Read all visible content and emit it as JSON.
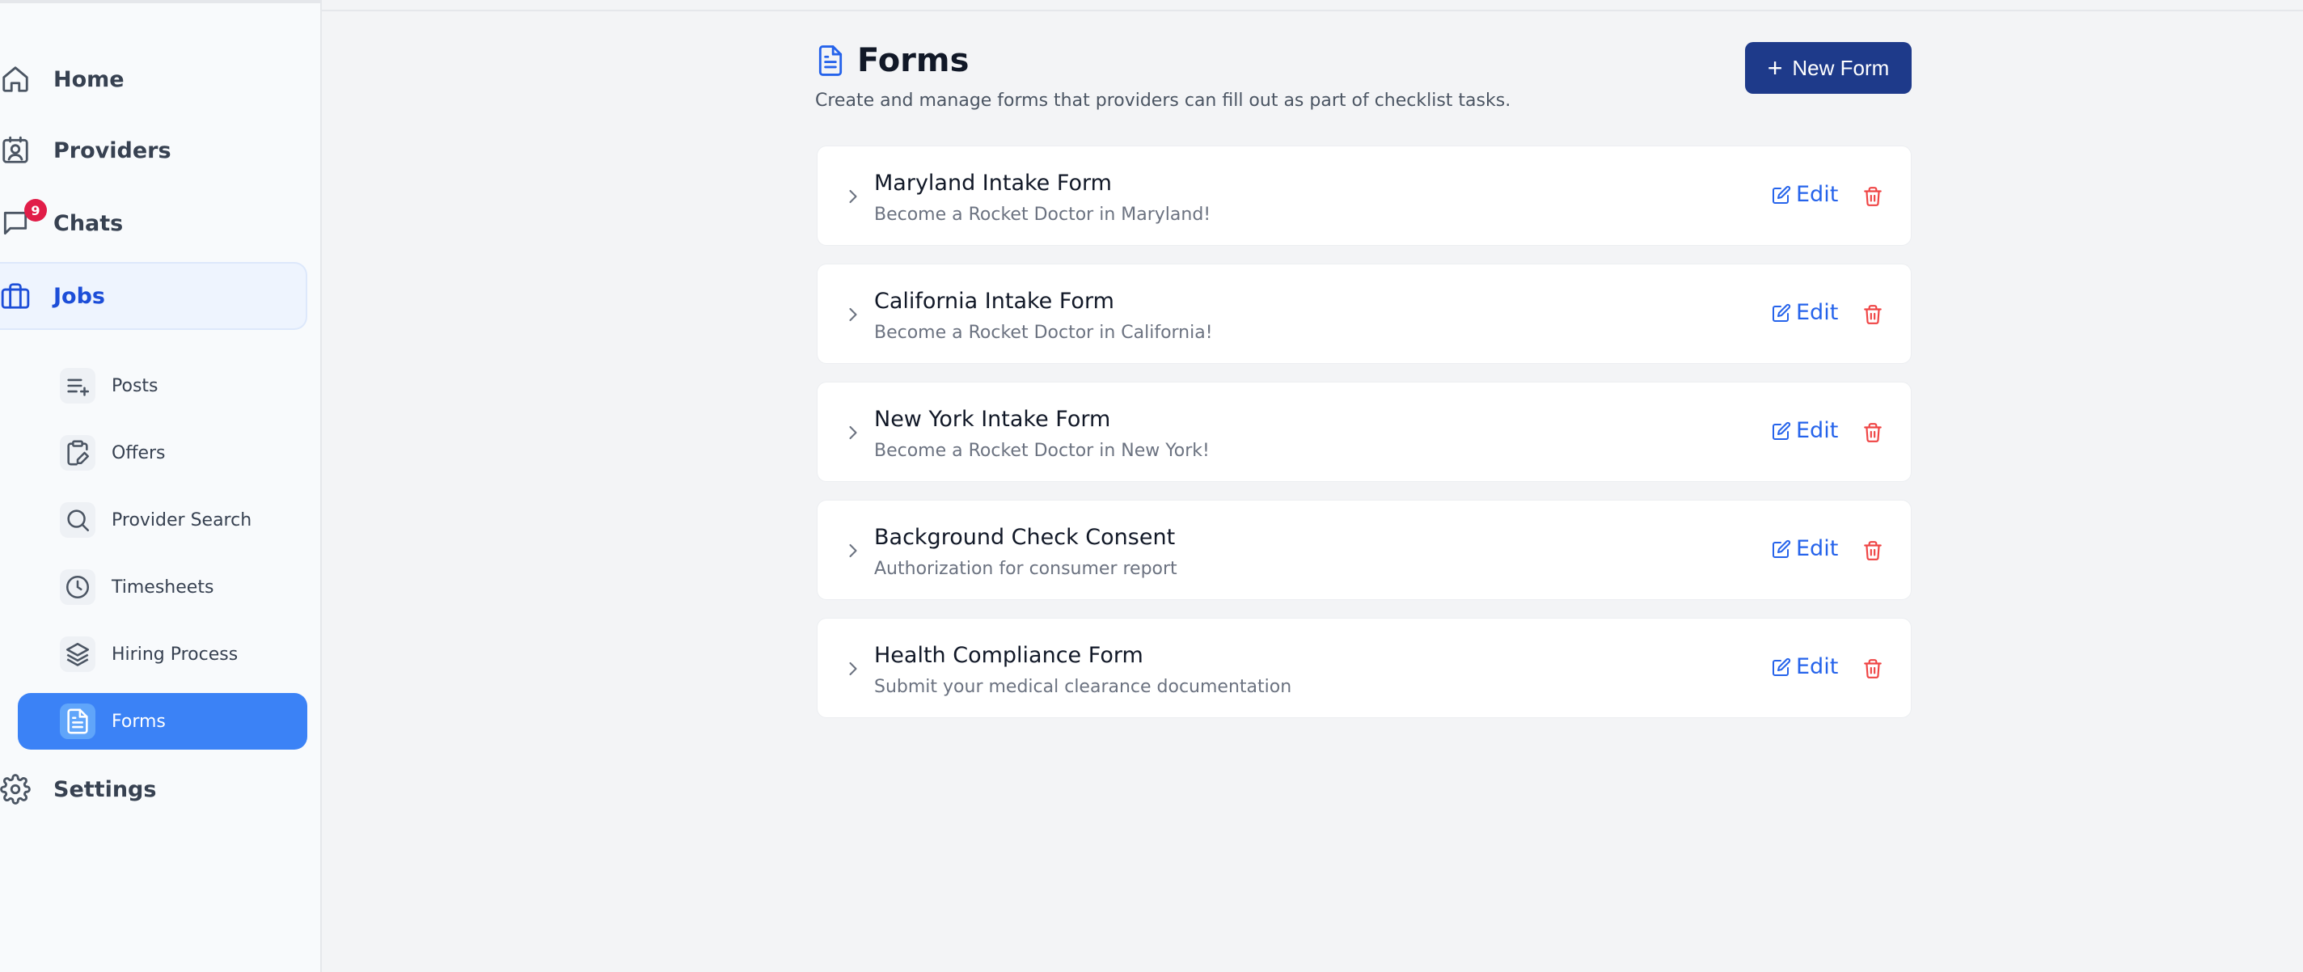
{
  "sidebar": {
    "items": [
      {
        "label": "Home",
        "icon": "home-icon"
      },
      {
        "label": "Providers",
        "icon": "contact-icon"
      },
      {
        "label": "Chats",
        "icon": "chat-icon",
        "badge": "9"
      },
      {
        "label": "Jobs",
        "icon": "briefcase-icon",
        "active": true
      },
      {
        "label": "Settings",
        "icon": "gear-icon"
      }
    ],
    "subitems": [
      {
        "label": "Posts",
        "icon": "list-plus-icon"
      },
      {
        "label": "Offers",
        "icon": "clipboard-pen-icon"
      },
      {
        "label": "Provider Search",
        "icon": "search-icon"
      },
      {
        "label": "Timesheets",
        "icon": "clock-icon"
      },
      {
        "label": "Hiring Process",
        "icon": "layers-icon"
      },
      {
        "label": "Forms",
        "icon": "file-text-icon",
        "active": true
      }
    ]
  },
  "page": {
    "title": "Forms",
    "subtitle": "Create and manage forms that providers can fill out as part of checklist tasks.",
    "new_button": "New Form"
  },
  "forms": [
    {
      "name": "Maryland Intake Form",
      "description": "Become a Rocket Doctor in Maryland!"
    },
    {
      "name": "California Intake Form",
      "description": "Become a Rocket Doctor in California!"
    },
    {
      "name": "New York Intake Form",
      "description": "Become a Rocket Doctor in New York!"
    },
    {
      "name": "Background Check Consent",
      "description": "Authorization for consumer report"
    },
    {
      "name": "Health Compliance Form",
      "description": "Submit your medical clearance documentation"
    }
  ],
  "actions": {
    "edit_label": "Edit"
  },
  "colors": {
    "accent": "#3b82f6",
    "primary_button": "#1e3a8a",
    "danger": "#ef4444",
    "link": "#2563eb"
  }
}
